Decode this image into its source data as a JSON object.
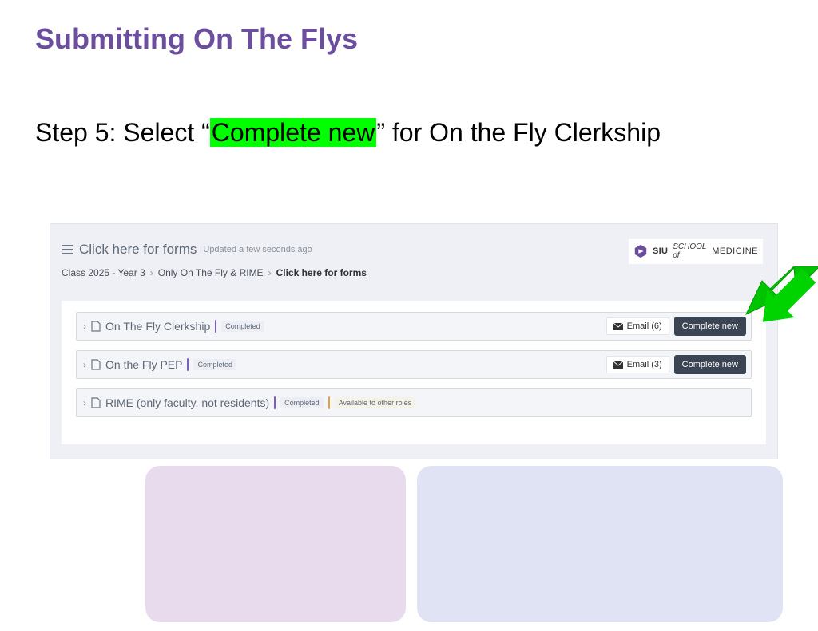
{
  "title": "Submitting On The Flys",
  "step": {
    "prefix": "Step 5: Select “",
    "highlight": "Complete new",
    "suffix": "” for On the Fly Clerkship"
  },
  "panel": {
    "forms_title": "Click here for forms",
    "updated": "Updated a few seconds ago",
    "crumbs": {
      "a": "Class 2025 - Year 3",
      "b": "Only On The Fly & RIME",
      "c": "Click here for forms"
    },
    "logo": {
      "bold": "SIU",
      "light": "SCHOOL of",
      "med": "MEDICINE"
    }
  },
  "rows": [
    {
      "title": "On The Fly Clerkship",
      "completed": "Completed",
      "email": "Email (6)",
      "cta": "Complete new"
    },
    {
      "title": "On the Fly PEP",
      "completed": "Completed",
      "email": "Email (3)",
      "cta": "Complete new"
    },
    {
      "title": "RIME (only faculty, not residents)",
      "completed": "Completed",
      "available": "Available to other roles"
    }
  ]
}
